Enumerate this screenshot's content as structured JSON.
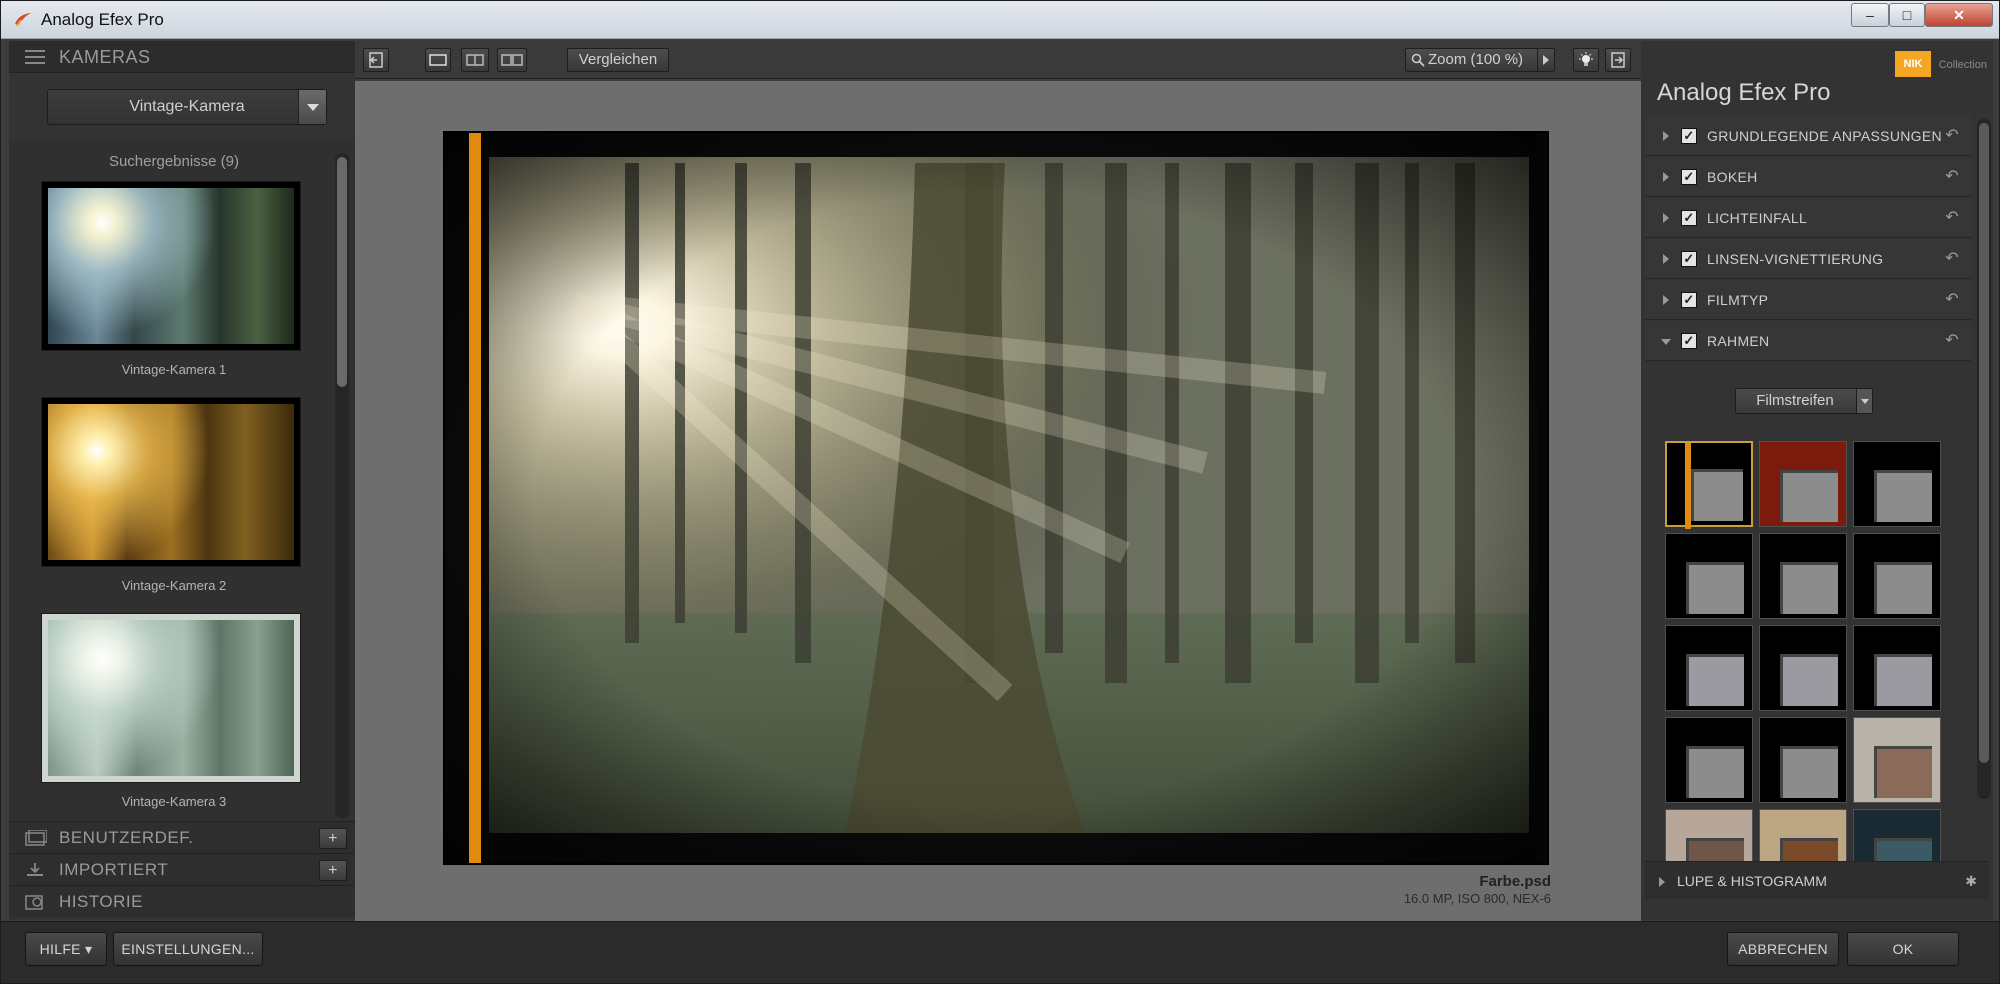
{
  "window": {
    "title": "Analog Efex Pro",
    "minimize": "–",
    "maximize": "□",
    "close": "✕"
  },
  "left_panel": {
    "cameras_header": "KAMERAS",
    "preset_select": "Vintage-Kamera",
    "results_title": "Suchergebnisse (9)",
    "results": [
      {
        "label": "Vintage-Kamera 1"
      },
      {
        "label": "Vintage-Kamera 2"
      },
      {
        "label": "Vintage-Kamera 3"
      }
    ],
    "sections": [
      {
        "label": "BENUTZERDEF.",
        "has_add": true
      },
      {
        "label": "IMPORTIERT",
        "has_add": true
      },
      {
        "label": "HISTORIE",
        "has_add": false
      }
    ],
    "add_label": "+"
  },
  "toolbar": {
    "compare_label": "Vergleichen",
    "zoom_label": "Zoom (100 %)"
  },
  "viewer": {
    "file_name": "Farbe.psd",
    "file_info": "16.0 MP, ISO 800, NEX-6"
  },
  "right_panel": {
    "brand": "NIK",
    "brand_sub": "Collection",
    "title": "Analog Efex Pro",
    "effects": [
      {
        "label": "GRUNDLEGENDE ANPASSUNGEN",
        "checked": true,
        "expanded": false
      },
      {
        "label": "BOKEH",
        "checked": true,
        "expanded": false
      },
      {
        "label": "LICHTEINFALL",
        "checked": true,
        "expanded": false
      },
      {
        "label": "LINSEN-VIGNETTIERUNG",
        "checked": true,
        "expanded": false
      },
      {
        "label": "FILMTYP",
        "checked": true,
        "expanded": false
      },
      {
        "label": "RAHMEN",
        "checked": true,
        "expanded": true
      }
    ],
    "frame_type_select": "Filmstreifen",
    "lupe_label": "LUPE & HISTOGRAMM"
  },
  "bottom_bar": {
    "help_label": "HILFE ▾",
    "settings_label": "EINSTELLUNGEN...",
    "cancel_label": "ABBRECHEN",
    "ok_label": "OK"
  },
  "colors": {
    "accent": "#f5a623",
    "panel": "#333333",
    "viewer_bg": "#6e6e6e"
  }
}
